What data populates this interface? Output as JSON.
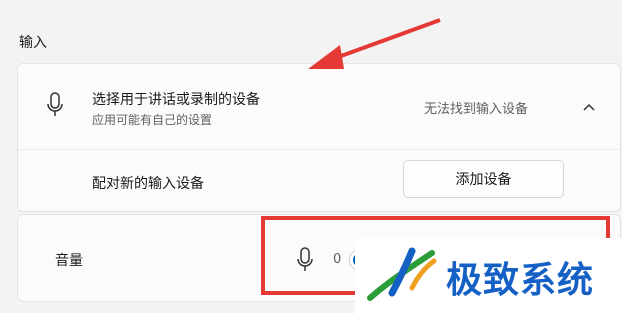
{
  "section": {
    "title": "输入"
  },
  "device_row": {
    "title": "选择用于讲话或录制的设备",
    "subtitle": "应用可能有自己的设置",
    "status": "无法找到输入设备",
    "icon": "microphone-icon",
    "expand_icon": "chevron-up-icon"
  },
  "pair_row": {
    "label": "配对新的输入设备",
    "button_label": "添加设备"
  },
  "volume_row": {
    "label": "音量",
    "value": "0",
    "icon": "microphone-icon"
  },
  "watermark": {
    "text": "极致系统"
  },
  "colors": {
    "accent": "#005fb8",
    "annotation": "#e53935",
    "watermark": "#1560c4"
  }
}
